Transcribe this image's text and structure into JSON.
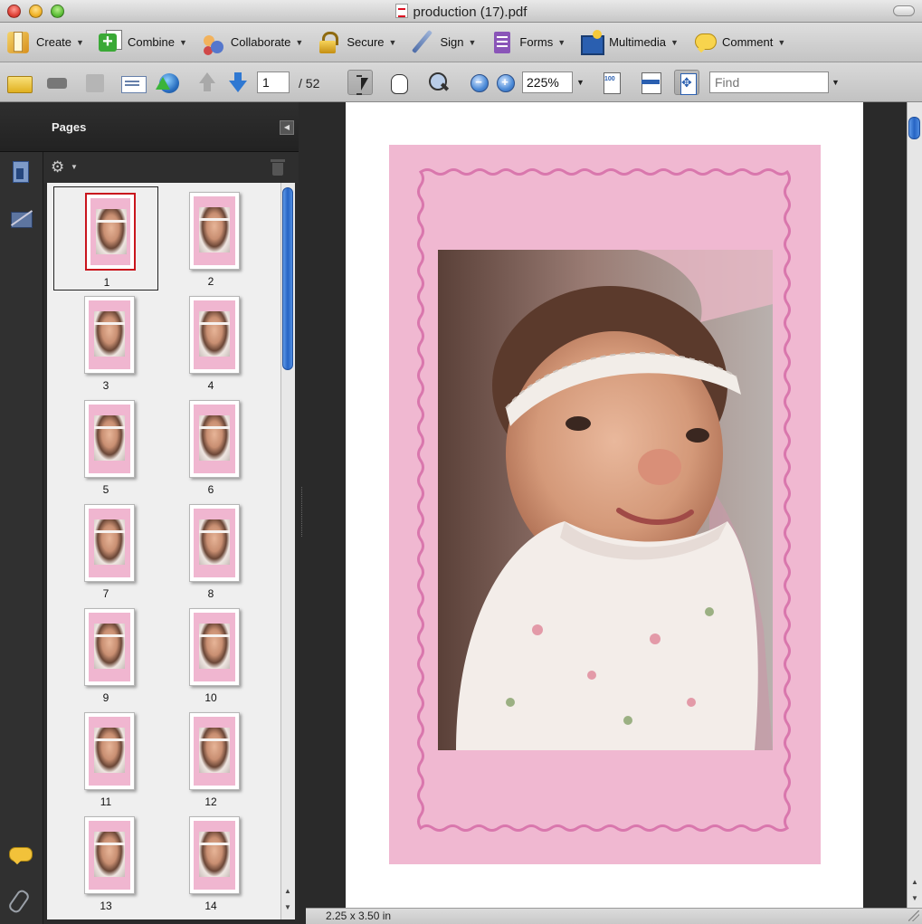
{
  "window": {
    "title": "production (17).pdf"
  },
  "tasks": [
    {
      "label": "Create",
      "icon": "create-icon"
    },
    {
      "label": "Combine",
      "icon": "combine-icon"
    },
    {
      "label": "Collaborate",
      "icon": "collaborate-icon"
    },
    {
      "label": "Secure",
      "icon": "lock-icon"
    },
    {
      "label": "Sign",
      "icon": "pen-icon"
    },
    {
      "label": "Forms",
      "icon": "forms-icon"
    },
    {
      "label": "Multimedia",
      "icon": "multimedia-icon"
    },
    {
      "label": "Comment",
      "icon": "comment-bubble-icon"
    }
  ],
  "navigation": {
    "current_page": "1",
    "total_pages": "/ 52",
    "zoom": "225%",
    "find_placeholder": "Find"
  },
  "pages_panel": {
    "title": "Pages",
    "thumbnails": [
      "1",
      "2",
      "3",
      "4",
      "5",
      "6",
      "7",
      "8",
      "9",
      "10",
      "11",
      "12",
      "13",
      "14"
    ],
    "selected": "1"
  },
  "status": {
    "page_size": "2.25 x 3.50 in"
  },
  "colors": {
    "frame_pink": "#f0b8d1",
    "wave_pink": "#d977ad",
    "selection_red": "#c9151d",
    "scroll_blue": "#2664c4"
  }
}
